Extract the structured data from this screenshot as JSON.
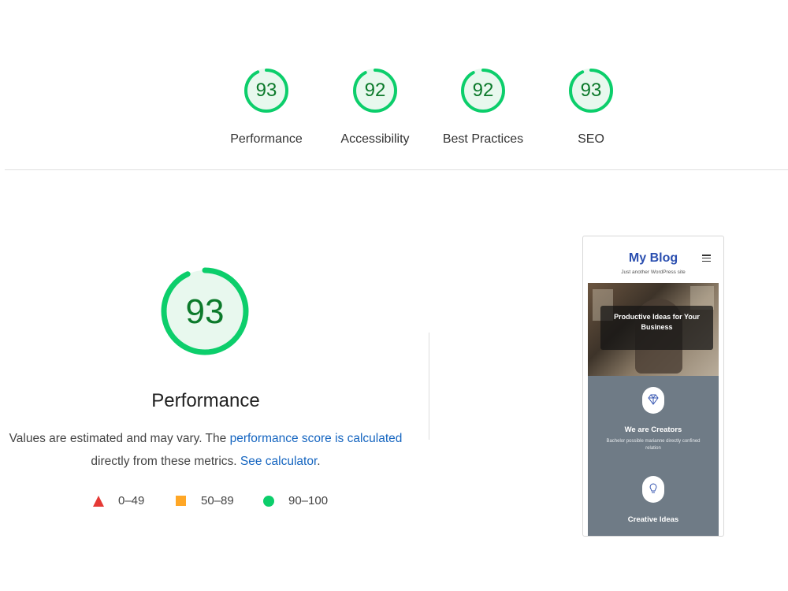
{
  "summary_gauges": [
    {
      "label": "Performance",
      "score": "93",
      "score_fraction": 0.93
    },
    {
      "label": "Accessibility",
      "score": "92",
      "score_fraction": 0.92
    },
    {
      "label": "Best Practices",
      "score": "92",
      "score_fraction": 0.92
    },
    {
      "label": "SEO",
      "score": "93",
      "score_fraction": 0.93
    }
  ],
  "performance": {
    "score": "93",
    "score_fraction": 0.93,
    "title": "Performance",
    "description_prefix": "Values are estimated and may vary. The ",
    "description_link": "performance score is calculated",
    "description_middle": "directly from these metrics. ",
    "calculator_link": "See calculator",
    "description_suffix": "."
  },
  "legend": [
    {
      "range": "0–49",
      "shape": "triangle",
      "color": "#e53935"
    },
    {
      "range": "50–89",
      "shape": "square",
      "color": "#ffa726"
    },
    {
      "range": "90–100",
      "shape": "circle",
      "color": "#0cce6b"
    }
  ],
  "colors": {
    "pass_ring": "#0cce6b",
    "pass_fill": "#e8f8ee",
    "pass_text": "#0c7a2b",
    "link": "#1565c0"
  },
  "screenshot": {
    "blog_title": "My Blog",
    "tagline": "Just another WordPress site",
    "hero_text": "Productive Ideas for Your Business",
    "features": [
      {
        "title": "We are Creators",
        "subtitle": "Bachelor possible marianne directly confined relation",
        "icon": "diamond-icon"
      },
      {
        "title": "Creative Ideas",
        "subtitle": "",
        "icon": "lightbulb-icon"
      }
    ]
  }
}
